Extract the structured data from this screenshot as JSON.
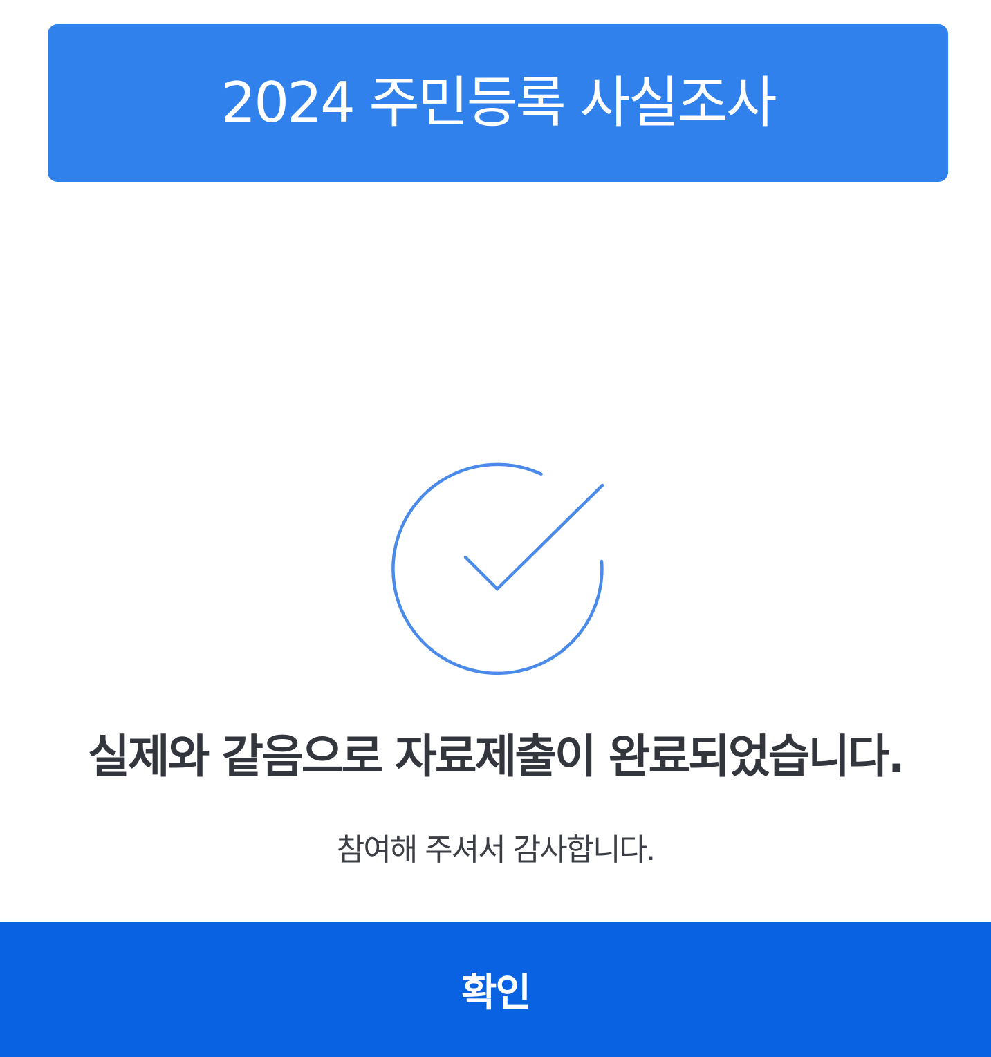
{
  "header": {
    "title": "2024 주민등록 사실조사",
    "background_color": "#3181ec"
  },
  "status": {
    "icon": "check-circle-icon",
    "icon_color": "#4a8ae8",
    "message": "실제와 같음으로 자료제출이 완료되었습니다.",
    "sub_message": "참여해 주셔서 감사합니다."
  },
  "footer": {
    "confirm_label": "확인",
    "button_color": "#0862e1"
  }
}
